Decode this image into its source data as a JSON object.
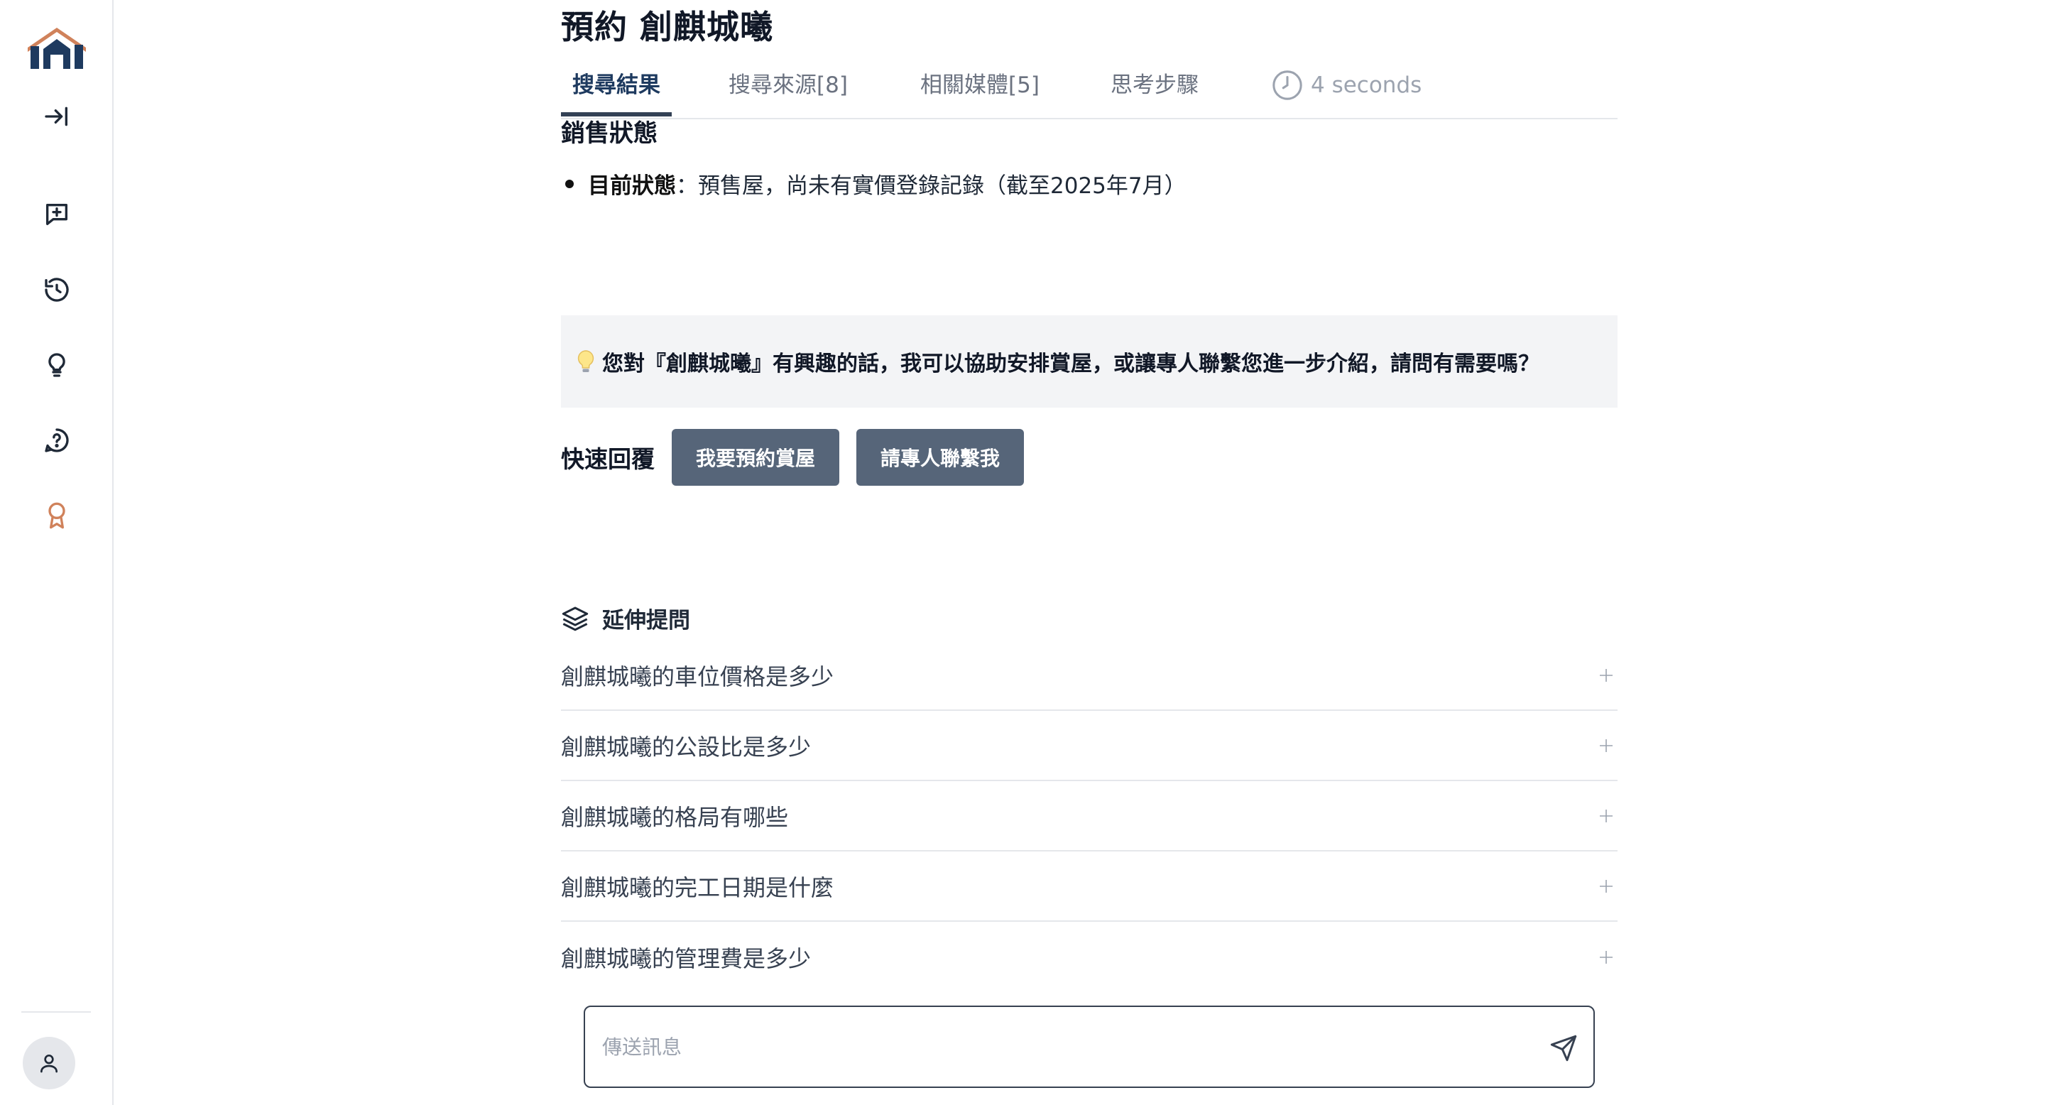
{
  "page": {
    "title": "預約 創麒城曦"
  },
  "tabs": [
    {
      "label": "搜尋結果",
      "active": true
    },
    {
      "label": "搜尋來源[8]",
      "active": false
    },
    {
      "label": "相關媒體[5]",
      "active": false
    },
    {
      "label": "思考步驟",
      "active": false
    }
  ],
  "timer": {
    "label": "4 seconds",
    "icon": "clock-icon"
  },
  "content": {
    "section_heading": "銷售狀態",
    "status_label": "目前狀態",
    "status_text": "：預售屋，尚未有實價登錄記錄（截至2025年7月）",
    "tip_icon": "lightbulb-icon",
    "tip_text": "您對『創麒城曦』有興趣的話，我可以協助安排賞屋，或讓專人聯繫您進一步介紹，請問有需要嗎？"
  },
  "quick_reply": {
    "label": "快速回覆",
    "buttons": [
      "我要預約賞屋",
      "請專人聯繫我"
    ],
    "button_color": "#566579"
  },
  "follow_up": {
    "heading": "延伸提問",
    "icon": "layers-icon",
    "items": [
      "創麒城曦的車位價格是多少",
      "創麒城曦的公設比是多少",
      "創麒城曦的格局有哪些",
      "創麒城曦的完工日期是什麼",
      "創麒城曦的管理費是多少"
    ]
  },
  "chat": {
    "placeholder": "傳送訊息",
    "send_icon": "send-icon"
  },
  "sidebar": {
    "items": [
      {
        "icon": "expand-sidebar-icon"
      },
      {
        "icon": "new-chat-icon"
      },
      {
        "icon": "history-icon"
      },
      {
        "icon": "lightbulb-icon"
      },
      {
        "icon": "help-icon"
      },
      {
        "icon": "award-icon",
        "color": "#d0825b"
      }
    ],
    "accent": "#d0825b",
    "brand": "#1e3a5f"
  }
}
